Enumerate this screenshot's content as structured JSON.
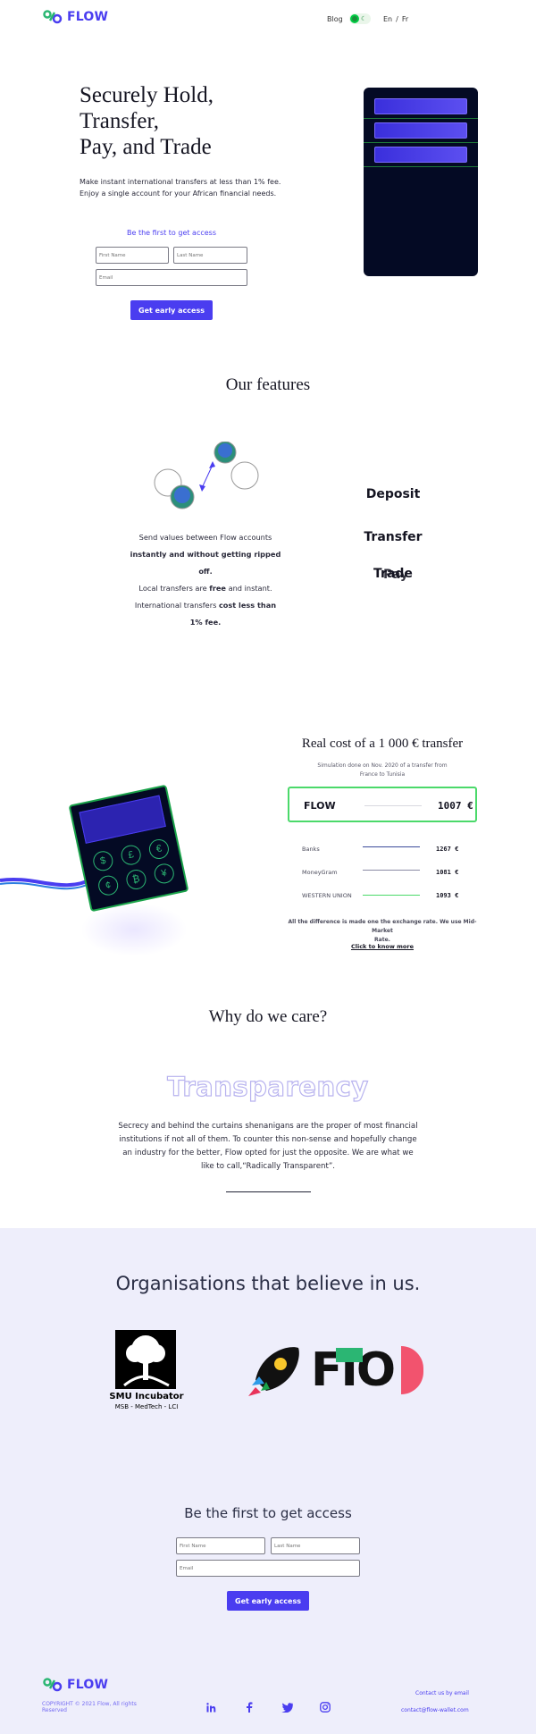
{
  "header": {
    "logo_text": "FLOW",
    "nav_blog": "Blog",
    "lang_en": "En",
    "lang_sep": "/",
    "lang_fr": "Fr",
    "accent_color": "#4a3df0"
  },
  "hero": {
    "title_line1": "Securely Hold,",
    "title_line2": "Transfer,",
    "title_line3": "Pay, and Trade",
    "subtitle_line1": "Make instant international transfers at less than 1% fee.",
    "subtitle_line2": "Enjoy a single account for your African financial needs.",
    "access_title": "Be the first to get access",
    "first_name_placeholder": "First Name",
    "last_name_placeholder": "Last Name",
    "email_placeholder": "Email",
    "cta_label": "Get early access"
  },
  "features": {
    "title": "Our features",
    "text_line1": "Send values between Flow accounts",
    "text_line2": "instantly and without getting ripped",
    "text_line3": "off.",
    "text_line4a": "Local transfers are ",
    "text_line4b": "free",
    "text_line4c": " and instant.",
    "text_line5a": "International transfers ",
    "text_line5b": "cost less than",
    "text_line6": "1% fee.",
    "tabs": [
      "Deposit",
      "Transfer",
      "Trade",
      "Pay"
    ]
  },
  "cost": {
    "title": "Real cost of a 1 000 € transfer",
    "note_line1": "Simulation done on Nov. 2020 of a transfer from",
    "note_line2": "France to Tunisia",
    "flow_label": "FLOW",
    "flow_value": "1007 €",
    "rows": [
      {
        "label": "Banks",
        "value": "1267 €"
      },
      {
        "label": "MoneyGram",
        "value": "1081 €"
      },
      {
        "label": "WESTERN UNION",
        "value": "1093 €"
      }
    ],
    "footnote_line1": "All the difference is made one the exchange rate. We use Mid-Market",
    "footnote_line2": "Rate.",
    "link": "Click to know more"
  },
  "care": {
    "title": "Why do we care?",
    "word": "Transparency",
    "text_line1": "Secrecy and behind the curtains shenanigans are the proper of most financial",
    "text_line2": "institutions if not all of them. To counter this non-sense and hopefully change",
    "text_line3": "an industry for the better, Flow opted for just the opposite. We are what we",
    "text_line4": "like to call,“Radically Transparent”."
  },
  "orgs": {
    "title": "Organisations that believe in us.",
    "smu_name": "SMU Incubator",
    "smu_sub": "MSB - MedTech - LCI",
    "fio_text": "FIO"
  },
  "cta": {
    "title": "Be the first to get access",
    "first_name_placeholder": "First Name",
    "last_name_placeholder": "Last Name",
    "email_placeholder": "Email",
    "button": "Get early access"
  },
  "footer": {
    "logo_text": "FLOW",
    "copyright_line1": "COPYRIGHT © 2021 Flow, All rights",
    "copyright_line2": "Reserved",
    "contact_label": "Contact us by email",
    "contact_email": "contact@flow-wallet.com",
    "socials": [
      "linkedin-icon",
      "facebook-icon",
      "twitter-icon",
      "instagram-icon"
    ]
  }
}
